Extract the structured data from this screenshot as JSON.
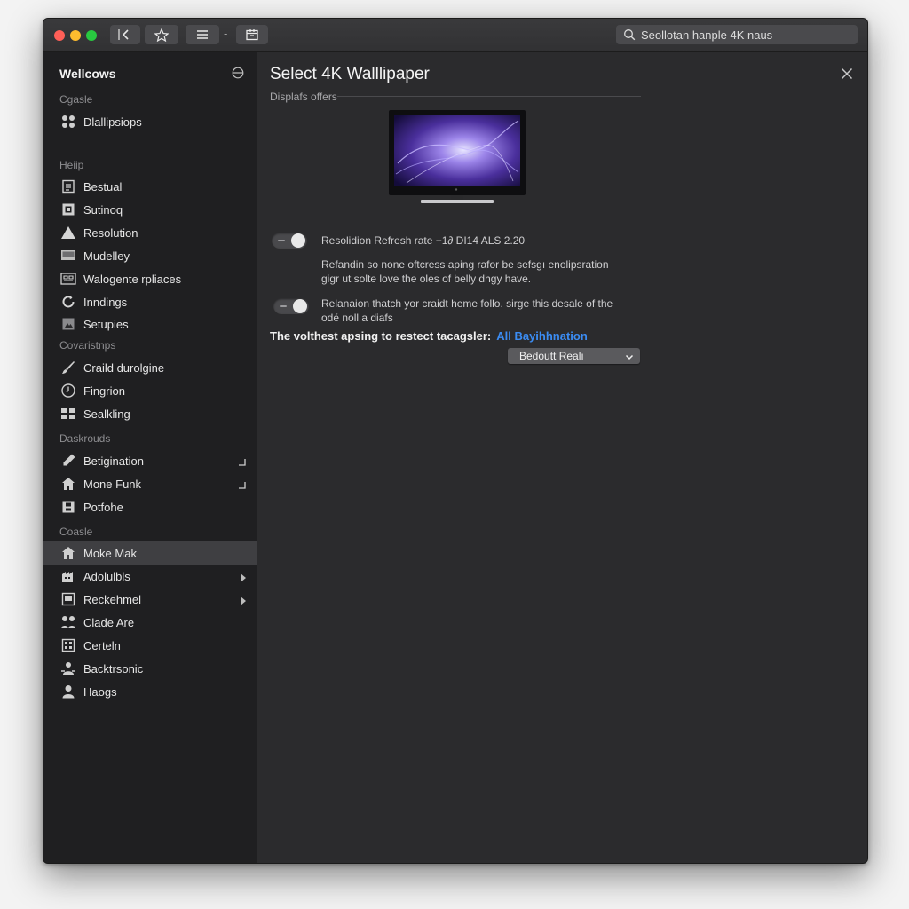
{
  "colors": {
    "window_bg": "#2b2b2d",
    "sidebar_bg": "#1f1f21",
    "selected_bg": "#3f3f42",
    "accent_link": "#3b8cf3",
    "traffic_close": "#ff5f57",
    "traffic_min": "#febc2e",
    "traffic_max": "#28c840"
  },
  "toolbar": {
    "back_icon": "back-arrow-icon",
    "star_icon": "star-icon",
    "list_icon": "list-icon",
    "folder_icon": "calendar-icon",
    "separator": "-",
    "search_placeholder": "Seollotan hanple  4K naus"
  },
  "sidebar": {
    "title": "Wellcows",
    "sections": [
      {
        "label": "Cgasle",
        "items": [
          {
            "label": "Dlallipsiops",
            "icon": "cluster-icon"
          }
        ]
      },
      {
        "label": "Heiip",
        "items": [
          {
            "label": "Bestual",
            "icon": "document-icon"
          },
          {
            "label": "Sutinoq",
            "icon": "panel-icon"
          },
          {
            "label": "Resolution",
            "icon": "triangle-icon"
          },
          {
            "label": "Mudelley",
            "icon": "monitor-icon"
          },
          {
            "label": "Walogente rpliaces",
            "icon": "grid-icon"
          },
          {
            "label": "Inndings",
            "icon": "refresh-icon"
          },
          {
            "label": "Setupies",
            "icon": "image-icon"
          }
        ]
      },
      {
        "label": "Covaristnps",
        "items": [
          {
            "label": "Craild durolgine",
            "icon": "brush-icon"
          },
          {
            "label": "Fingrion",
            "icon": "clock-icon"
          },
          {
            "label": "Sealkling",
            "icon": "table-icon"
          }
        ]
      },
      {
        "label": "Daskrouds",
        "items": [
          {
            "label": "Betigination",
            "icon": "pencil-icon",
            "trail": "corner-icon"
          },
          {
            "label": "Mone Funk",
            "icon": "home-icon",
            "trail": "corner-icon"
          },
          {
            "label": "Potfohe",
            "icon": "save-icon"
          }
        ]
      },
      {
        "label": "Coasle",
        "items": [
          {
            "label": "Moke Mak",
            "icon": "home-icon",
            "selected": true
          },
          {
            "label": "Adolulbls",
            "icon": "building-icon",
            "trail": "chevron-right-icon"
          },
          {
            "label": "Reckehmel",
            "icon": "screen-icon",
            "trail": "chevron-right-icon"
          },
          {
            "label": "Clade Are",
            "icon": "people-icon"
          },
          {
            "label": "Certeln",
            "icon": "grid-icon"
          },
          {
            "label": "Backtrsonic",
            "icon": "group-icon"
          },
          {
            "label": "Haogs",
            "icon": "user-icon"
          }
        ]
      }
    ]
  },
  "main": {
    "title": "Select 4K Walllipaper",
    "subtitle": "Displafs offers",
    "toggle1": {
      "label": "Resolidion Refresh rate −1∂ DI14 ALS 2.20",
      "on": true
    },
    "paragraph1": [
      "Refandin so none oftcress aping rafor be sefsgı enolipsration",
      "gigr ut solte love the oles of belly dhgy have."
    ],
    "toggle2": {
      "on": true
    },
    "paragraph2": [
      "Relanaion thatch yor craidt heme follo. sirge this desale of the",
      "odé noll a diafs"
    ],
    "prompt": "The volthest apsing to restect tacagsler:",
    "link": "All Bayihhnation",
    "dropdown_value": "Bedoutt Realı"
  }
}
